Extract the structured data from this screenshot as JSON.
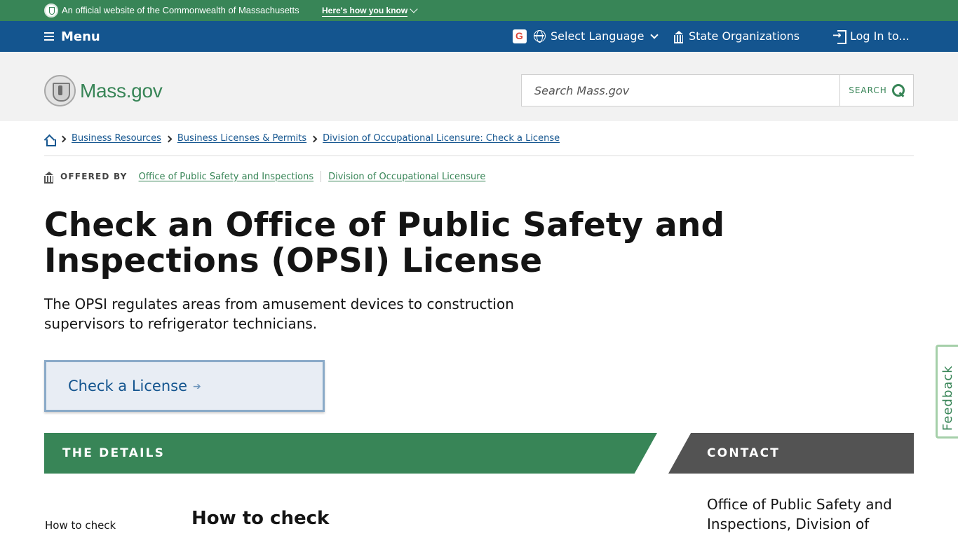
{
  "official_banner": {
    "text": "An official website of the Commonwealth of Massachusetts",
    "link": "Here's how you know"
  },
  "utility_nav": {
    "menu_label": "Menu",
    "language_label": "Select Language",
    "state_orgs_label": "State Organizations",
    "login_label": "Log In to..."
  },
  "header": {
    "logo_text": "Mass.gov",
    "search_placeholder": "Search Mass.gov",
    "search_button": "SEARCH"
  },
  "breadcrumb": {
    "items": [
      "Business Resources",
      "Business Licenses & Permits",
      "Division of Occupational Licensure: Check a License"
    ]
  },
  "offered_by": {
    "label": "OFFERED BY",
    "orgs": [
      "Office of Public Safety and Inspections",
      "Division of Occupational Licensure"
    ]
  },
  "page": {
    "title": "Check an Office of Public Safety and Inspections (OPSI) License",
    "lede": "The OPSI regulates areas from amusement devices to construction supervisors to refrigerator technicians.",
    "cta_label": "Check a License",
    "cta_arrow": "➔"
  },
  "sections": {
    "details_heading": "THE DETAILS",
    "contact_heading": "CONTACT",
    "toc_first_item": "How to check",
    "first_section_heading": "How to check",
    "contact_org": "Office of Public Safety and Inspections, Division of"
  },
  "feedback": {
    "label": "Feedback"
  },
  "colors": {
    "brand_green": "#388557",
    "nav_blue": "#14558f",
    "header_gray": "#f2f2f2",
    "contact_gray": "#535353"
  }
}
